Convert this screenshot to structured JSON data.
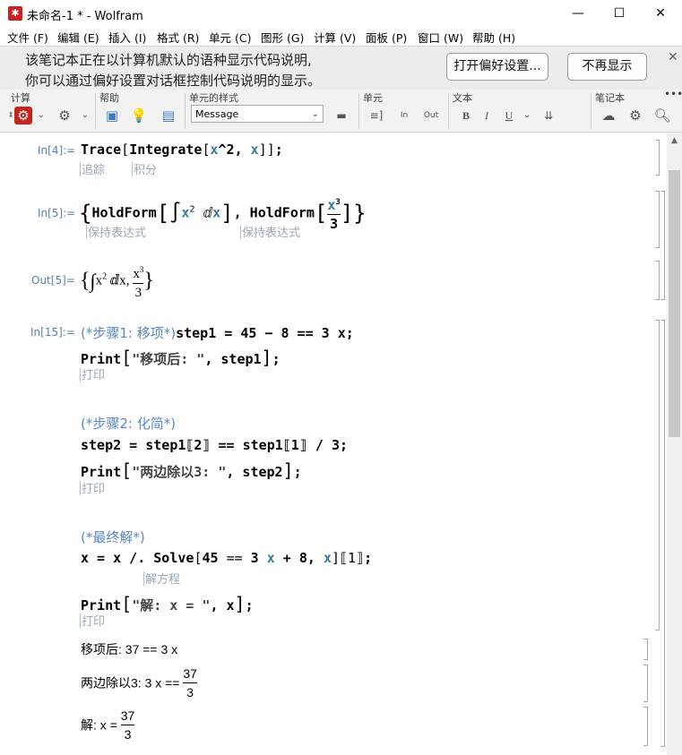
{
  "window": {
    "title": "未命名-1 * - Wolfram",
    "minimize": "—",
    "maximize": "☐",
    "close": "✕"
  },
  "menu": [
    "文件 (F)",
    "编辑 (E)",
    "插入 (I)",
    "格式 (R)",
    "单元 (C)",
    "图形 (G)",
    "计算 (V)",
    "面板 (P)",
    "窗口 (W)",
    "帮助 (H)"
  ],
  "banner": {
    "line1": "该笔记本正在以计算机默认的语种显示代码说明,",
    "line2": "你可以通过偏好设置对话框控制代码说明的显示。",
    "open_prefs": "打开偏好设置...",
    "dont_show": "不再显示",
    "close": "✕"
  },
  "toolbar": {
    "groups": [
      "计算",
      "帮助",
      "单元的样式",
      "单元",
      "文本",
      "笔记本"
    ],
    "style_value": "Message",
    "more": "•••"
  },
  "cells": {
    "c1": {
      "label": "In[4]:=",
      "hint1": "追踪",
      "hint2": "积分"
    },
    "c2": {
      "label": "In[5]:=",
      "hint1": "保持表达式",
      "hint2": "保持表达式"
    },
    "c3": {
      "label": "Out[5]="
    },
    "c4": {
      "label": "In[15]:=",
      "comment1": "(*步骤1: 移项*)",
      "line1": "step1 = 45 − 8 == 3 x;",
      "print1_str": "\"移项后: \"",
      "hint_print": "打印",
      "comment2": "(*步骤2: 化简*)",
      "line2": "step2 = step1⟦2⟧ == step1⟦1⟧ / 3;",
      "print2_str": "\"两边除以3: \"",
      "comment3": "(*最终解*)",
      "hint_solve": "解方程",
      "print3_str": "\"解: x = \""
    }
  },
  "outputs": {
    "o1": "移项后: 37 == 3 x",
    "o2_prefix": "两边除以3: 3 x ==",
    "o2_num": "37",
    "o2_den": "3",
    "o3_prefix": "解: x =",
    "o3_num": "37",
    "o3_den": "3"
  }
}
